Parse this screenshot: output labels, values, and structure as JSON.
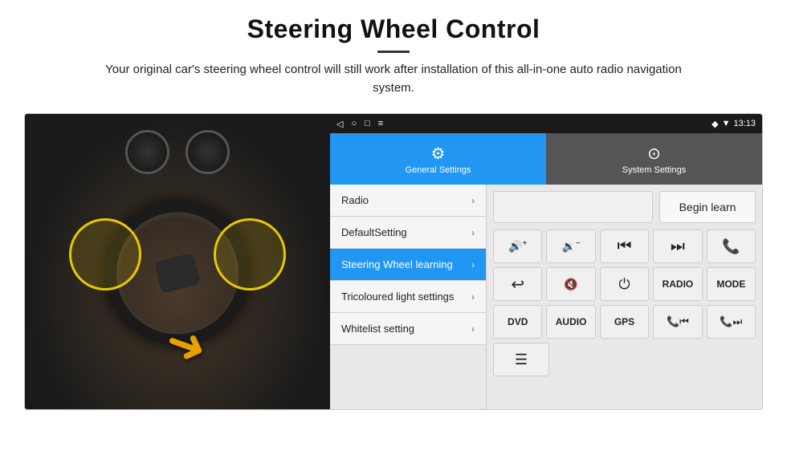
{
  "header": {
    "title": "Steering Wheel Control",
    "divider": true,
    "subtitle": "Your original car's steering wheel control will still work after installation of this all-in-one auto radio navigation system."
  },
  "statusBar": {
    "time": "13:13",
    "navIcons": [
      "◁",
      "○",
      "□",
      "≡"
    ]
  },
  "settingsTabs": [
    {
      "id": "general",
      "label": "General Settings",
      "icon": "⚙",
      "active": true
    },
    {
      "id": "system",
      "label": "System Settings",
      "icon": "⊙",
      "active": false
    }
  ],
  "menuItems": [
    {
      "id": "radio",
      "label": "Radio",
      "active": false
    },
    {
      "id": "default-setting",
      "label": "DefaultSetting",
      "active": false
    },
    {
      "id": "steering-wheel",
      "label": "Steering Wheel learning",
      "active": true
    },
    {
      "id": "tricoloured",
      "label": "Tricoloured light settings",
      "active": false
    },
    {
      "id": "whitelist",
      "label": "Whitelist setting",
      "active": false
    }
  ],
  "controls": {
    "beginLearn": "Begin learn",
    "rows": [
      [
        {
          "type": "icon",
          "icon": "🔊+",
          "label": "vol-up"
        },
        {
          "type": "icon",
          "icon": "🔉−",
          "label": "vol-down"
        },
        {
          "type": "icon",
          "icon": "⏮",
          "label": "prev-track"
        },
        {
          "type": "icon",
          "icon": "⏭",
          "label": "next-track"
        },
        {
          "type": "icon",
          "icon": "📞",
          "label": "call"
        }
      ],
      [
        {
          "type": "icon",
          "icon": "↩",
          "label": "back"
        },
        {
          "type": "icon",
          "icon": "🔇×",
          "label": "mute"
        },
        {
          "type": "icon",
          "icon": "⏻",
          "label": "power"
        },
        {
          "type": "text",
          "label": "RADIO"
        },
        {
          "type": "text",
          "label": "MODE"
        }
      ],
      [
        {
          "type": "text",
          "label": "DVD"
        },
        {
          "type": "text",
          "label": "AUDIO"
        },
        {
          "type": "text",
          "label": "GPS"
        },
        {
          "type": "icon",
          "icon": "📞⏮",
          "label": "call-prev"
        },
        {
          "type": "icon",
          "icon": "📞⏭",
          "label": "call-next"
        }
      ]
    ],
    "bottomRow": [
      {
        "type": "icon",
        "icon": "≡",
        "label": "menu-icon"
      }
    ]
  }
}
